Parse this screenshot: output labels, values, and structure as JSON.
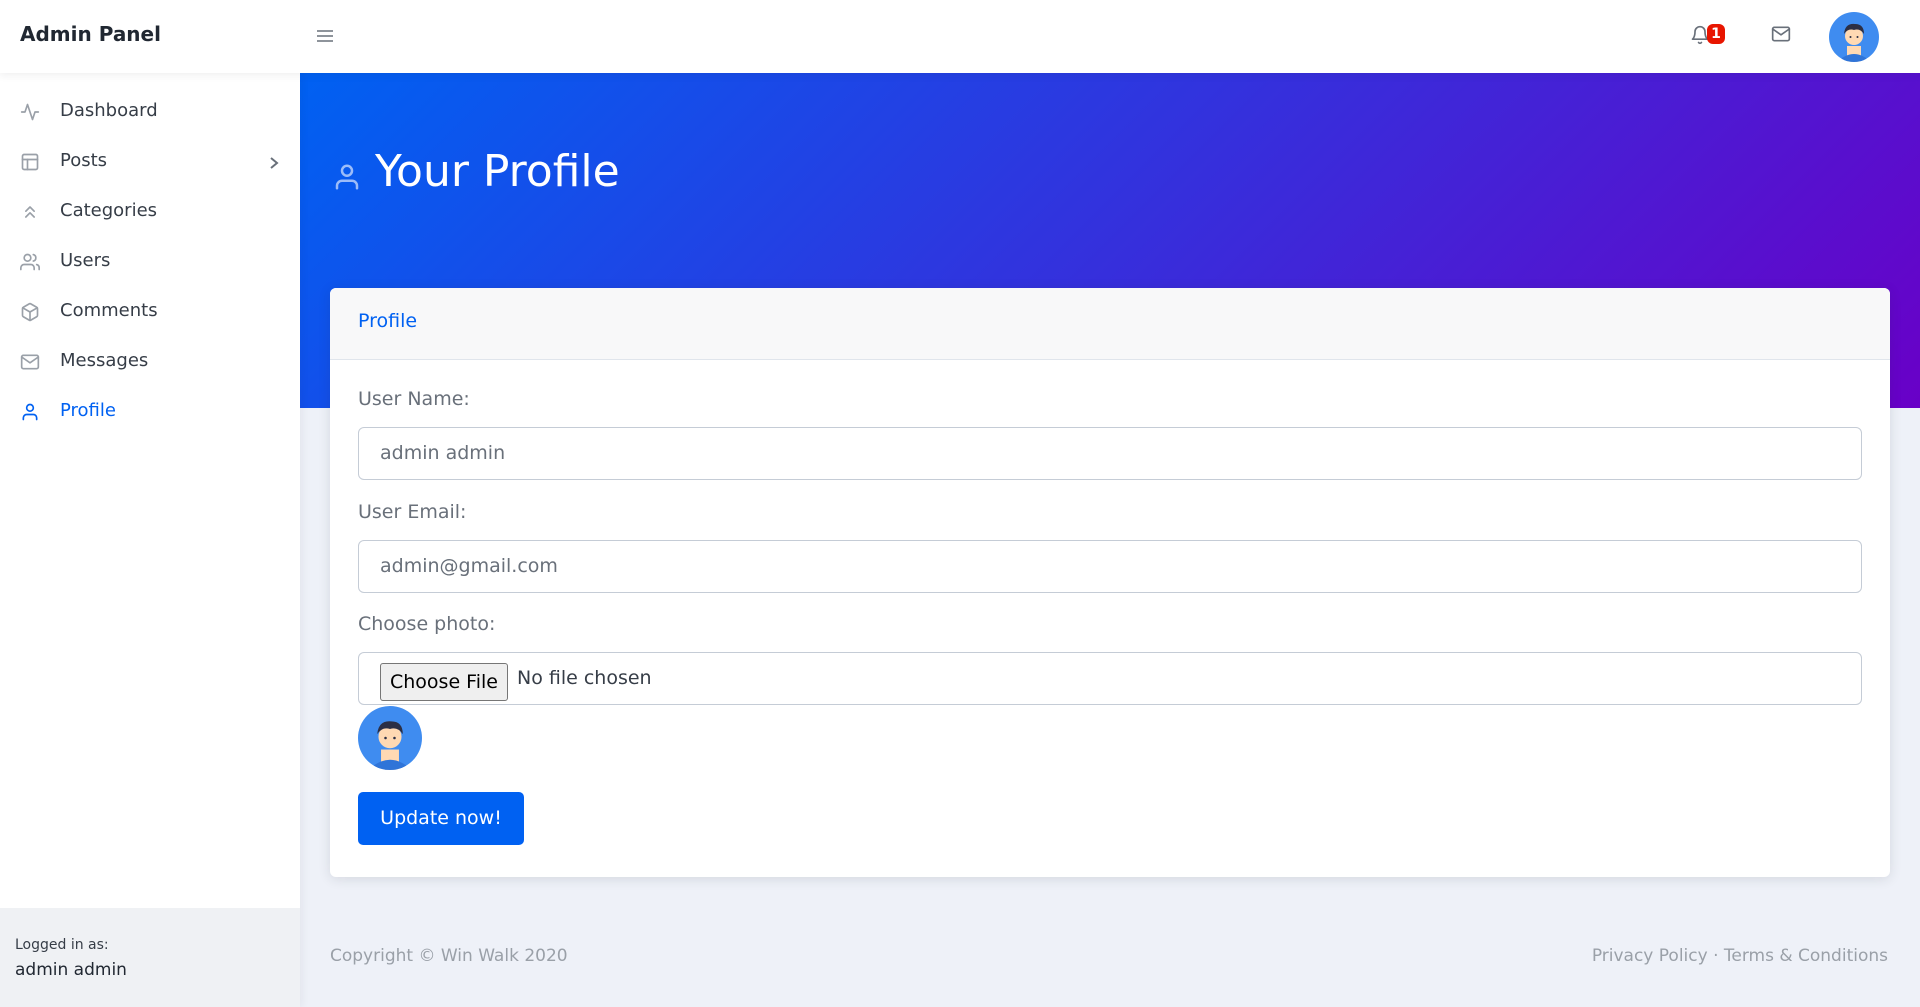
{
  "app": {
    "title": "Admin Panel"
  },
  "topbar": {
    "notification_count": "1"
  },
  "sidebar": {
    "items": [
      {
        "label": "Dashboard",
        "icon": "activity-icon",
        "active": false
      },
      {
        "label": "Posts",
        "icon": "layout-icon",
        "active": false,
        "has_submenu": true
      },
      {
        "label": "Categories",
        "icon": "chevrons-up-icon",
        "active": false
      },
      {
        "label": "Users",
        "icon": "users-icon",
        "active": false
      },
      {
        "label": "Comments",
        "icon": "package-icon",
        "active": false
      },
      {
        "label": "Messages",
        "icon": "mail-icon",
        "active": false
      },
      {
        "label": "Profile",
        "icon": "user-icon",
        "active": true
      }
    ],
    "footer": {
      "subtitle": "Logged in as:",
      "name": "admin admin"
    }
  },
  "header": {
    "title": "Your Profile"
  },
  "card": {
    "title": "Profile",
    "fields": {
      "username_label": "User Name:",
      "username_value": "admin admin",
      "email_label": "User Email:",
      "email_value": "admin@gmail.com",
      "photo_label": "Choose photo:",
      "file_button": "Choose File",
      "file_status": "No file chosen"
    },
    "submit_label": "Update now!"
  },
  "footer": {
    "copyright": "Copyright © Win Walk 2020",
    "privacy": "Privacy Policy",
    "separator": "·",
    "terms": "Terms & Conditions"
  },
  "colors": {
    "primary": "#0061f2",
    "gradient_end": "#6900c7",
    "badge": "#e81500"
  }
}
